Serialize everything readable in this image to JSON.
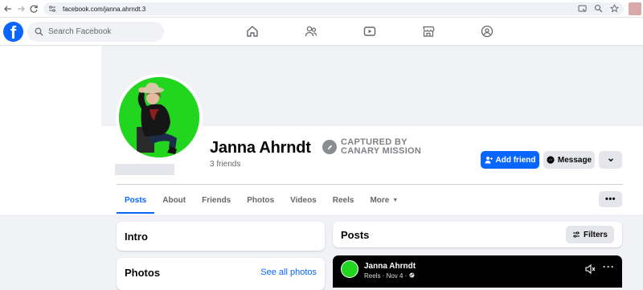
{
  "browser": {
    "url": "facebook.com/janna.ahrndt.3"
  },
  "header": {
    "logo": "f",
    "search_placeholder": "Search Facebook",
    "nav_icons": [
      "home-icon",
      "friends-icon",
      "watch-icon",
      "marketplace-icon",
      "groups-icon"
    ]
  },
  "profile": {
    "name": "Janna Ahrndt",
    "friends": "3 friends",
    "watermark": {
      "line1": "CAPTURED BY",
      "line2": "CANARY MISSION"
    },
    "add_friend": "Add friend",
    "message": "Message"
  },
  "tabs": {
    "items": [
      "Posts",
      "About",
      "Friends",
      "Photos",
      "Videos",
      "Reels",
      "More"
    ],
    "active": "Posts"
  },
  "intro": {
    "title": "Intro"
  },
  "photos": {
    "title": "Photos",
    "see_all": "See all photos"
  },
  "posts": {
    "title": "Posts",
    "filters": "Filters"
  },
  "reel_post": {
    "author": "Janna Ahrndt",
    "meta": "Reels · Nov 4 · "
  },
  "colors": {
    "accent": "#0866ff",
    "avatar_bg": "#22d61f",
    "page_bg": "#f0f2f5"
  }
}
